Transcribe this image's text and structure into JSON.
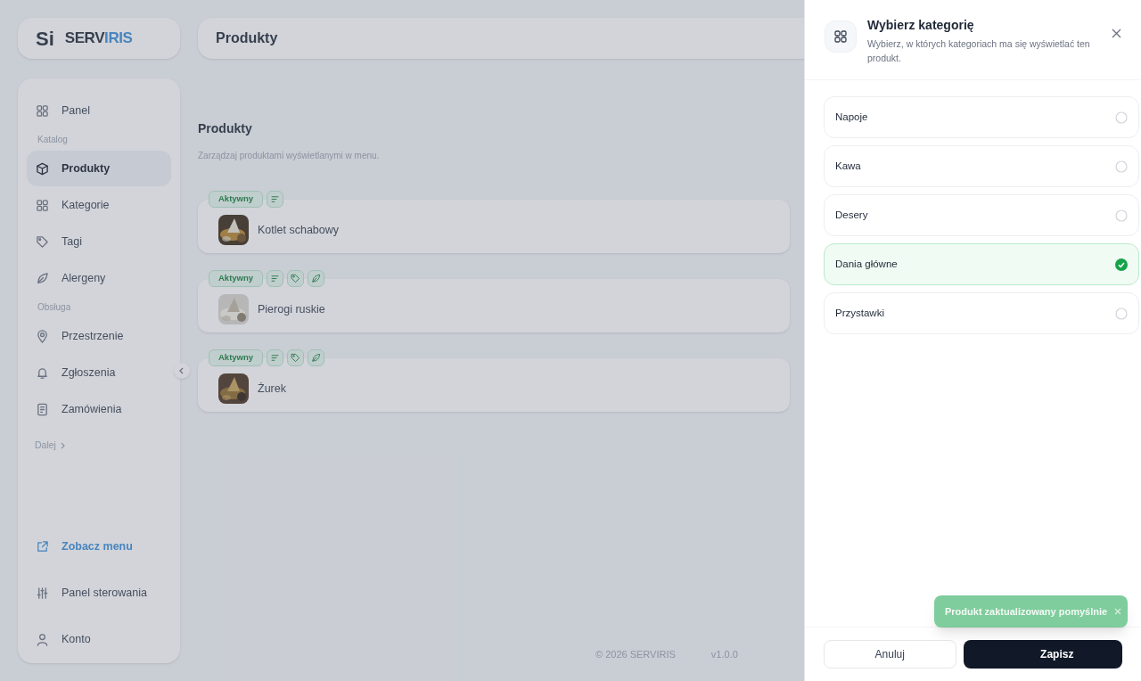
{
  "logo": {
    "mark": "Si",
    "name_dark": "SERV",
    "name_accent": "IRIS"
  },
  "header": {
    "title": "Produkty"
  },
  "sidebar": {
    "items": [
      {
        "kind": "item",
        "label": "Panel",
        "selected": false
      },
      {
        "kind": "section",
        "label": "Katalog"
      },
      {
        "kind": "item",
        "label": "Produkty",
        "selected": true
      },
      {
        "kind": "item",
        "label": "Kategorie",
        "selected": false
      },
      {
        "kind": "item",
        "label": "Tagi",
        "selected": false
      },
      {
        "kind": "item",
        "label": "Alergeny",
        "selected": false
      },
      {
        "kind": "section",
        "label": "Obsługa"
      },
      {
        "kind": "item",
        "label": "Przestrzenie",
        "selected": false
      },
      {
        "kind": "item",
        "label": "Zgłoszenia",
        "selected": false
      },
      {
        "kind": "item",
        "label": "Zamówienia",
        "selected": false
      },
      {
        "kind": "more",
        "label": "Dalej"
      }
    ],
    "bottom": [
      {
        "kind": "link",
        "label": "Zobacz menu"
      },
      {
        "kind": "item",
        "label": "Panel sterowania"
      },
      {
        "kind": "item",
        "label": "Konto"
      }
    ]
  },
  "page": {
    "title": "Produkty",
    "subtitle": "Zarządzaj produktami wyświetlanymi w menu."
  },
  "products": [
    {
      "status": "Aktywny",
      "flags": [
        {
          "kind": "description"
        }
      ],
      "name": "Kotlet schabowy"
    },
    {
      "status": "Aktywny",
      "flags": [
        {
          "kind": "description"
        },
        {
          "kind": "tags"
        },
        {
          "kind": "allergens"
        }
      ],
      "name": "Pierogi ruskie"
    },
    {
      "status": "Aktywny",
      "flags": [
        {
          "kind": "description"
        },
        {
          "kind": "tags"
        },
        {
          "kind": "allergens"
        }
      ],
      "name": "Żurek"
    }
  ],
  "footer": {
    "copyright": "© 2026 SERVIRIS",
    "version": "v1.0.0"
  },
  "drawer": {
    "title": "Wybierz kategorię",
    "subtitle": "Wybierz, w których kategoriach ma się wyświetlać ten produkt.",
    "options": [
      {
        "label": "Napoje",
        "selected": false
      },
      {
        "label": "Kawa",
        "selected": false
      },
      {
        "label": "Desery",
        "selected": false
      },
      {
        "label": "Dania główne",
        "selected": true
      },
      {
        "label": "Przystawki",
        "selected": false
      }
    ],
    "buttons": {
      "cancel": "Anuluj",
      "save": "Zapisz"
    }
  },
  "toast": {
    "message": "Produkt zaktualizowany pomyślnie"
  }
}
